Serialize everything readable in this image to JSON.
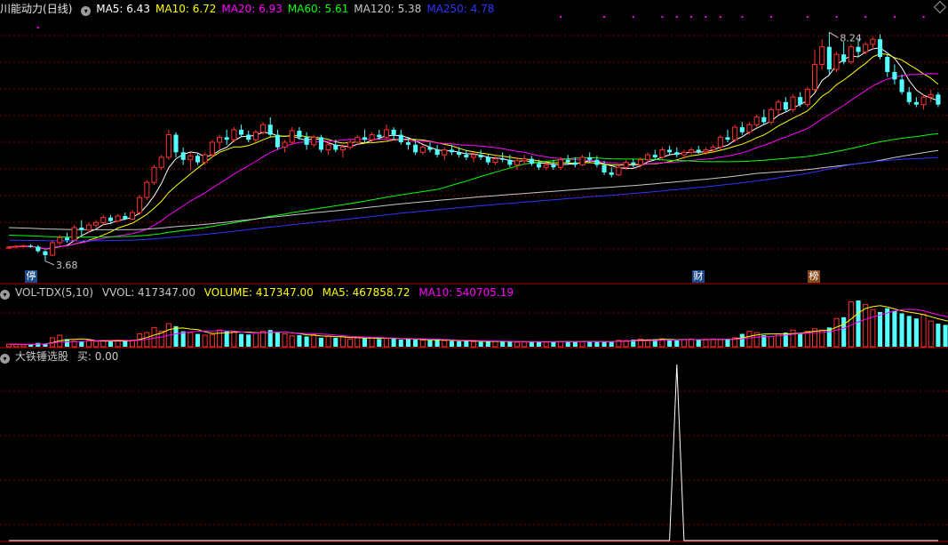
{
  "header": {
    "stock_name": "川能动力",
    "period": "(日线)",
    "ma": [
      {
        "label": "MA5",
        "value": "6.43",
        "color": "#ffffff"
      },
      {
        "label": "MA10",
        "value": "6.72",
        "color": "#ffff00"
      },
      {
        "label": "MA20",
        "value": "6.93",
        "color": "#ff00ff"
      },
      {
        "label": "MA60",
        "value": "5.61",
        "color": "#00ff00"
      },
      {
        "label": "MA120",
        "value": "5.38",
        "color": "#c8c8c8"
      },
      {
        "label": "MA250",
        "value": "4.78",
        "color": "#3333ff"
      }
    ]
  },
  "volume_header": {
    "indicator": "VOL-TDX(5,10)",
    "vvol": "VVOL: 417347.00",
    "volume": "VOLUME: 417347.00",
    "ma5": "MA5: 467858.72",
    "ma10": "MA10: 540705.19"
  },
  "signal_header": {
    "name": "大铁锤选股",
    "buy": "买: 0.00"
  },
  "markers": {
    "ting": "停",
    "cai": "财",
    "bang": "榜"
  },
  "colors": {
    "up": "#ff3030",
    "down": "#54ffff",
    "grid": "#8b0000",
    "frame": "#b40000"
  },
  "chart_data": {
    "type": "candlestick",
    "price_annotations": {
      "high": "8.24",
      "low": "3.68"
    },
    "ylim": [
      3.5,
      8.6
    ],
    "ohlc": [
      [
        3.95,
        3.98,
        3.92,
        3.96
      ],
      [
        3.96,
        4.0,
        3.93,
        3.98
      ],
      [
        3.98,
        4.01,
        3.95,
        3.99
      ],
      [
        3.99,
        4.02,
        3.95,
        3.97
      ],
      [
        3.97,
        4.0,
        3.85,
        3.88
      ],
      [
        3.88,
        3.9,
        3.68,
        3.8
      ],
      [
        3.8,
        4.1,
        3.78,
        4.05
      ],
      [
        4.05,
        4.2,
        4.0,
        4.15
      ],
      [
        4.15,
        4.25,
        4.05,
        4.1
      ],
      [
        4.1,
        4.4,
        4.08,
        4.35
      ],
      [
        4.35,
        4.5,
        4.2,
        4.3
      ],
      [
        4.3,
        4.45,
        4.25,
        4.4
      ],
      [
        4.4,
        4.5,
        4.35,
        4.45
      ],
      [
        4.45,
        4.6,
        4.4,
        4.55
      ],
      [
        4.55,
        4.6,
        4.42,
        4.48
      ],
      [
        4.48,
        4.62,
        4.45,
        4.58
      ],
      [
        4.58,
        4.65,
        4.5,
        4.52
      ],
      [
        4.52,
        4.7,
        4.5,
        4.65
      ],
      [
        4.65,
        5.0,
        4.6,
        4.95
      ],
      [
        4.95,
        5.3,
        4.9,
        5.25
      ],
      [
        5.25,
        5.6,
        5.2,
        5.55
      ],
      [
        5.55,
        5.8,
        5.5,
        5.75
      ],
      [
        5.75,
        6.3,
        5.7,
        6.2
      ],
      [
        6.2,
        6.25,
        5.75,
        5.85
      ],
      [
        5.85,
        5.95,
        5.6,
        5.7
      ],
      [
        5.7,
        5.85,
        5.5,
        5.78
      ],
      [
        5.78,
        5.82,
        5.6,
        5.65
      ],
      [
        5.65,
        5.85,
        5.6,
        5.8
      ],
      [
        5.8,
        6.1,
        5.75,
        6.05
      ],
      [
        6.05,
        6.2,
        5.9,
        6.15
      ],
      [
        6.15,
        6.3,
        6.0,
        6.1
      ],
      [
        6.1,
        6.35,
        6.05,
        6.3
      ],
      [
        6.3,
        6.4,
        6.15,
        6.2
      ],
      [
        6.2,
        6.28,
        6.05,
        6.1
      ],
      [
        6.1,
        6.3,
        6.05,
        6.25
      ],
      [
        6.25,
        6.45,
        6.2,
        6.4
      ],
      [
        6.4,
        6.55,
        6.15,
        6.2
      ],
      [
        6.2,
        6.3,
        5.9,
        5.95
      ],
      [
        5.95,
        6.1,
        5.85,
        6.05
      ],
      [
        6.05,
        6.35,
        6.0,
        6.28
      ],
      [
        6.28,
        6.35,
        6.1,
        6.15
      ],
      [
        6.15,
        6.25,
        5.9,
        6.0
      ],
      [
        6.0,
        6.2,
        5.95,
        6.15
      ],
      [
        6.15,
        6.2,
        5.85,
        5.9
      ],
      [
        5.9,
        6.05,
        5.8,
        6.0
      ],
      [
        6.0,
        6.1,
        5.85,
        5.9
      ],
      [
        5.9,
        6.0,
        5.75,
        5.95
      ],
      [
        5.95,
        6.1,
        5.9,
        6.05
      ],
      [
        6.05,
        6.2,
        6.0,
        6.15
      ],
      [
        6.15,
        6.3,
        6.05,
        6.1
      ],
      [
        6.1,
        6.25,
        6.05,
        6.2
      ],
      [
        6.2,
        6.3,
        6.1,
        6.15
      ],
      [
        6.15,
        6.4,
        6.1,
        6.3
      ],
      [
        6.3,
        6.35,
        6.1,
        6.2
      ],
      [
        6.2,
        6.3,
        6.0,
        6.05
      ],
      [
        6.05,
        6.15,
        5.9,
        6.0
      ],
      [
        6.0,
        6.1,
        5.8,
        5.85
      ],
      [
        5.85,
        6.0,
        5.8,
        5.95
      ],
      [
        5.95,
        6.05,
        5.85,
        5.9
      ],
      [
        5.9,
        6.0,
        5.75,
        5.8
      ],
      [
        5.8,
        5.95,
        5.7,
        5.9
      ],
      [
        5.9,
        6.0,
        5.8,
        5.85
      ],
      [
        5.85,
        5.95,
        5.75,
        5.8
      ],
      [
        5.8,
        5.9,
        5.7,
        5.75
      ],
      [
        5.75,
        5.85,
        5.65,
        5.8
      ],
      [
        5.8,
        5.9,
        5.7,
        5.75
      ],
      [
        5.75,
        5.8,
        5.6,
        5.65
      ],
      [
        5.65,
        5.8,
        5.6,
        5.72
      ],
      [
        5.72,
        5.85,
        5.65,
        5.7
      ],
      [
        5.7,
        5.8,
        5.55,
        5.6
      ],
      [
        5.6,
        5.75,
        5.5,
        5.68
      ],
      [
        5.68,
        5.8,
        5.6,
        5.72
      ],
      [
        5.72,
        5.78,
        5.58,
        5.62
      ],
      [
        5.62,
        5.7,
        5.5,
        5.55
      ],
      [
        5.55,
        5.65,
        5.5,
        5.6
      ],
      [
        5.6,
        5.7,
        5.5,
        5.55
      ],
      [
        5.55,
        5.75,
        5.5,
        5.7
      ],
      [
        5.7,
        5.8,
        5.6,
        5.65
      ],
      [
        5.65,
        5.75,
        5.55,
        5.6
      ],
      [
        5.6,
        5.8,
        5.58,
        5.75
      ],
      [
        5.75,
        5.85,
        5.65,
        5.7
      ],
      [
        5.7,
        5.78,
        5.55,
        5.6
      ],
      [
        5.6,
        5.68,
        5.4,
        5.45
      ],
      [
        5.45,
        5.55,
        5.35,
        5.4
      ],
      [
        5.4,
        5.58,
        5.38,
        5.55
      ],
      [
        5.55,
        5.7,
        5.5,
        5.65
      ],
      [
        5.65,
        5.72,
        5.55,
        5.6
      ],
      [
        5.6,
        5.75,
        5.55,
        5.7
      ],
      [
        5.7,
        5.85,
        5.65,
        5.8
      ],
      [
        5.8,
        5.9,
        5.7,
        5.75
      ],
      [
        5.75,
        5.95,
        5.7,
        5.9
      ],
      [
        5.9,
        5.98,
        5.8,
        5.85
      ],
      [
        5.85,
        5.95,
        5.75,
        5.8
      ],
      [
        5.8,
        5.9,
        5.72,
        5.85
      ],
      [
        5.85,
        5.95,
        5.8,
        5.9
      ],
      [
        5.9,
        5.98,
        5.82,
        5.86
      ],
      [
        5.86,
        5.95,
        5.8,
        5.9
      ],
      [
        5.9,
        6.0,
        5.85,
        5.95
      ],
      [
        5.95,
        6.2,
        5.9,
        6.15
      ],
      [
        6.15,
        6.3,
        6.05,
        6.1
      ],
      [
        6.1,
        6.4,
        6.05,
        6.35
      ],
      [
        6.35,
        6.45,
        6.2,
        6.25
      ],
      [
        6.25,
        6.45,
        6.2,
        6.4
      ],
      [
        6.4,
        6.6,
        6.35,
        6.55
      ],
      [
        6.55,
        6.7,
        6.4,
        6.45
      ],
      [
        6.45,
        6.75,
        6.4,
        6.7
      ],
      [
        6.7,
        6.9,
        6.6,
        6.85
      ],
      [
        6.85,
        6.95,
        6.65,
        6.7
      ],
      [
        6.7,
        7.0,
        6.65,
        6.95
      ],
      [
        6.95,
        7.05,
        6.75,
        6.8
      ],
      [
        6.8,
        7.15,
        6.75,
        7.1
      ],
      [
        7.1,
        7.9,
        7.05,
        7.6
      ],
      [
        7.6,
        8.1,
        7.5,
        7.95
      ],
      [
        7.95,
        8.24,
        7.4,
        7.5
      ],
      [
        7.5,
        7.85,
        7.45,
        7.8
      ],
      [
        7.8,
        8.05,
        7.6,
        7.65
      ],
      [
        7.65,
        8.0,
        7.6,
        7.95
      ],
      [
        7.95,
        8.1,
        7.75,
        7.85
      ],
      [
        7.85,
        8.05,
        7.8,
        8.0
      ],
      [
        8.0,
        8.15,
        7.9,
        8.1
      ],
      [
        8.1,
        8.2,
        7.7,
        7.75
      ],
      [
        7.75,
        7.8,
        7.35,
        7.45
      ],
      [
        7.45,
        7.6,
        7.2,
        7.3
      ],
      [
        7.3,
        7.4,
        7.0,
        7.05
      ],
      [
        7.05,
        7.15,
        6.8,
        6.85
      ],
      [
        6.85,
        6.95,
        6.75,
        6.8
      ],
      [
        6.8,
        7.0,
        6.7,
        6.95
      ],
      [
        6.95,
        7.1,
        6.85,
        7.0
      ],
      [
        7.0,
        7.05,
        6.75,
        6.8
      ]
    ],
    "volume": [
      20,
      18,
      15,
      20,
      30,
      25,
      70,
      90,
      60,
      45,
      40,
      50,
      42,
      45,
      40,
      50,
      45,
      52,
      100,
      110,
      150,
      120,
      180,
      160,
      120,
      110,
      100,
      90,
      95,
      130,
      125,
      120,
      100,
      95,
      110,
      120,
      130,
      110,
      100,
      85,
      90,
      80,
      95,
      70,
      80,
      70,
      75,
      60,
      70,
      65,
      72,
      60,
      68,
      62,
      55,
      58,
      55,
      52,
      50,
      54,
      48,
      45,
      42,
      45,
      40,
      38,
      42,
      45,
      38,
      40,
      35,
      38,
      42,
      40,
      36,
      38,
      40,
      45,
      42,
      38,
      44,
      40,
      38,
      42,
      50,
      48,
      55,
      60,
      52,
      58,
      62,
      55,
      50,
      55,
      60,
      52,
      58,
      60,
      55,
      62,
      70,
      100,
      120,
      110,
      90,
      80,
      100,
      110,
      130,
      105,
      120,
      140,
      130,
      150,
      220,
      230,
      350,
      360,
      330,
      290,
      270,
      300,
      280,
      260,
      240,
      220,
      250,
      200,
      180,
      170,
      160,
      200,
      190,
      170,
      165
    ],
    "signal": {
      "peak_index": 92,
      "peak_value": 1
    }
  }
}
